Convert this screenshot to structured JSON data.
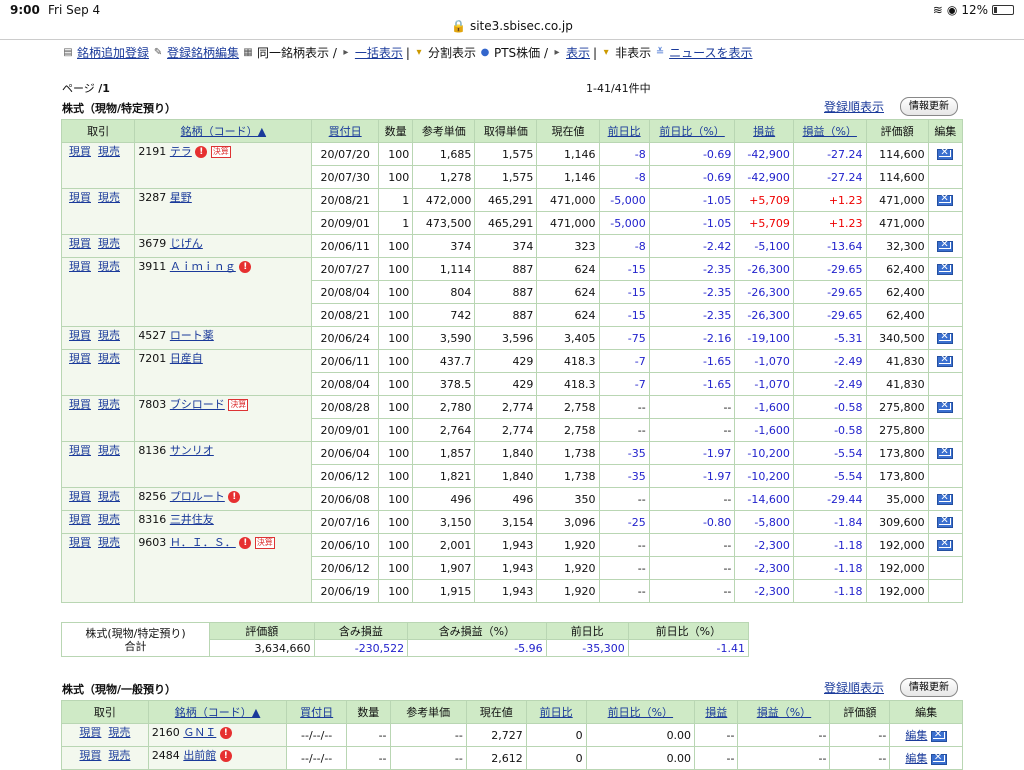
{
  "status": {
    "time": "9:00",
    "date": "Fri Sep 4",
    "url": "site3.sbisec.co.jp",
    "battery": "12%"
  },
  "toolbar": {
    "add": "銘柄追加登録",
    "edit": "登録銘柄編集",
    "same_label": "同一銘柄表示 /",
    "bulk": "一括表示",
    "split_label": "分割表示",
    "pts_label": "PTS株価 /",
    "pts_show": "表示",
    "sep": "|",
    "hidden_label": "非表示",
    "news": "ニュースを表示"
  },
  "page": {
    "label": "ページ",
    "num": "/1",
    "count": "1-41/41件中"
  },
  "section1": {
    "title": "株式（現物/特定預り）",
    "sort": "登録順表示",
    "refresh": "情報更新",
    "headers": [
      "取引",
      "銘柄（コード）▲",
      "買付日",
      "数量",
      "参考単価",
      "取得単価",
      "現在値",
      "前日比",
      "前日比（%）",
      "損益",
      "損益（%）",
      "評価額",
      "編集"
    ],
    "groups": [
      {
        "code": "2191",
        "name": "テラ",
        "ex": true,
        "kess": true,
        "rows": [
          [
            "20/07/20",
            "100",
            "1,685",
            "1,575",
            "1,146",
            "-8",
            "-0.69",
            "-42,900",
            "-27.24",
            "114,600"
          ],
          [
            "20/07/30",
            "100",
            "1,278",
            "1,575",
            "1,146",
            "-8",
            "-0.69",
            "-42,900",
            "-27.24",
            "114,600"
          ]
        ]
      },
      {
        "code": "3287",
        "name": "星野",
        "ex": false,
        "kess": false,
        "rows": [
          [
            "20/08/21",
            "1",
            "472,000",
            "465,291",
            "471,000",
            "-5,000",
            "-1.05",
            "+5,709",
            "+1.23",
            "471,000"
          ],
          [
            "20/09/01",
            "1",
            "473,500",
            "465,291",
            "471,000",
            "-5,000",
            "-1.05",
            "+5,709",
            "+1.23",
            "471,000"
          ]
        ]
      },
      {
        "code": "3679",
        "name": "じげん",
        "ex": false,
        "kess": false,
        "rows": [
          [
            "20/06/11",
            "100",
            "374",
            "374",
            "323",
            "-8",
            "-2.42",
            "-5,100",
            "-13.64",
            "32,300"
          ]
        ]
      },
      {
        "code": "3911",
        "name": "Ａｉｍｉｎｇ",
        "ex": true,
        "kess": false,
        "rows": [
          [
            "20/07/27",
            "100",
            "1,114",
            "887",
            "624",
            "-15",
            "-2.35",
            "-26,300",
            "-29.65",
            "62,400"
          ],
          [
            "20/08/04",
            "100",
            "804",
            "887",
            "624",
            "-15",
            "-2.35",
            "-26,300",
            "-29.65",
            "62,400"
          ],
          [
            "20/08/21",
            "100",
            "742",
            "887",
            "624",
            "-15",
            "-2.35",
            "-26,300",
            "-29.65",
            "62,400"
          ]
        ]
      },
      {
        "code": "4527",
        "name": "ロート薬",
        "ex": false,
        "kess": false,
        "rows": [
          [
            "20/06/24",
            "100",
            "3,590",
            "3,596",
            "3,405",
            "-75",
            "-2.16",
            "-19,100",
            "-5.31",
            "340,500"
          ]
        ]
      },
      {
        "code": "7201",
        "name": "日産自",
        "ex": false,
        "kess": false,
        "rows": [
          [
            "20/06/11",
            "100",
            "437.7",
            "429",
            "418.3",
            "-7",
            "-1.65",
            "-1,070",
            "-2.49",
            "41,830"
          ],
          [
            "20/08/04",
            "100",
            "378.5",
            "429",
            "418.3",
            "-7",
            "-1.65",
            "-1,070",
            "-2.49",
            "41,830"
          ]
        ]
      },
      {
        "code": "7803",
        "name": "ブシロード",
        "ex": false,
        "kess": true,
        "rows": [
          [
            "20/08/28",
            "100",
            "2,780",
            "2,774",
            "2,758",
            "--",
            "--",
            "-1,600",
            "-0.58",
            "275,800"
          ],
          [
            "20/09/01",
            "100",
            "2,764",
            "2,774",
            "2,758",
            "--",
            "--",
            "-1,600",
            "-0.58",
            "275,800"
          ]
        ]
      },
      {
        "code": "8136",
        "name": "サンリオ",
        "ex": false,
        "kess": false,
        "rows": [
          [
            "20/06/04",
            "100",
            "1,857",
            "1,840",
            "1,738",
            "-35",
            "-1.97",
            "-10,200",
            "-5.54",
            "173,800"
          ],
          [
            "20/06/12",
            "100",
            "1,821",
            "1,840",
            "1,738",
            "-35",
            "-1.97",
            "-10,200",
            "-5.54",
            "173,800"
          ]
        ]
      },
      {
        "code": "8256",
        "name": "プロルート",
        "ex": true,
        "kess": false,
        "rows": [
          [
            "20/06/08",
            "100",
            "496",
            "496",
            "350",
            "--",
            "--",
            "-14,600",
            "-29.44",
            "35,000"
          ]
        ]
      },
      {
        "code": "8316",
        "name": "三井住友",
        "ex": false,
        "kess": false,
        "rows": [
          [
            "20/07/16",
            "100",
            "3,150",
            "3,154",
            "3,096",
            "-25",
            "-0.80",
            "-5,800",
            "-1.84",
            "309,600"
          ]
        ]
      },
      {
        "code": "9603",
        "name": "Ｈ．Ｉ．Ｓ．",
        "ex": true,
        "kess": true,
        "rows": [
          [
            "20/06/10",
            "100",
            "2,001",
            "1,943",
            "1,920",
            "--",
            "--",
            "-2,300",
            "-1.18",
            "192,000"
          ],
          [
            "20/06/12",
            "100",
            "1,907",
            "1,943",
            "1,920",
            "--",
            "--",
            "-2,300",
            "-1.18",
            "192,000"
          ],
          [
            "20/06/19",
            "100",
            "1,915",
            "1,943",
            "1,920",
            "--",
            "--",
            "-2,300",
            "-1.18",
            "192,000"
          ]
        ]
      }
    ],
    "buy": "現買",
    "sell": "現売"
  },
  "summary": {
    "label1": "株式(現物/特定預り)",
    "label2": "合計",
    "headers": [
      "評価額",
      "含み損益",
      "含み損益（%）",
      "前日比",
      "前日比（%）"
    ],
    "values": [
      "3,634,660",
      "-230,522",
      "-5.96",
      "-35,300",
      "-1.41"
    ]
  },
  "section2": {
    "title": "株式（現物/一般預り）",
    "sort": "登録順表示",
    "refresh": "情報更新",
    "headers": [
      "取引",
      "銘柄（コード）▲",
      "買付日",
      "数量",
      "参考単価",
      "現在値",
      "前日比",
      "前日比（%）",
      "損益",
      "損益（%）",
      "評価額",
      "編集"
    ],
    "rows": [
      {
        "code": "2160",
        "name": "ＧＮＩ",
        "cells": [
          "--/--/--",
          "--",
          "--",
          "2,727",
          "0",
          "0.00",
          "--",
          "--",
          "--"
        ],
        "edit": "編集"
      },
      {
        "code": "2484",
        "name": "出前館",
        "cells": [
          "--/--/--",
          "--",
          "--",
          "2,612",
          "0",
          "0.00",
          "--",
          "--",
          "--"
        ],
        "edit": "編集"
      }
    ]
  }
}
